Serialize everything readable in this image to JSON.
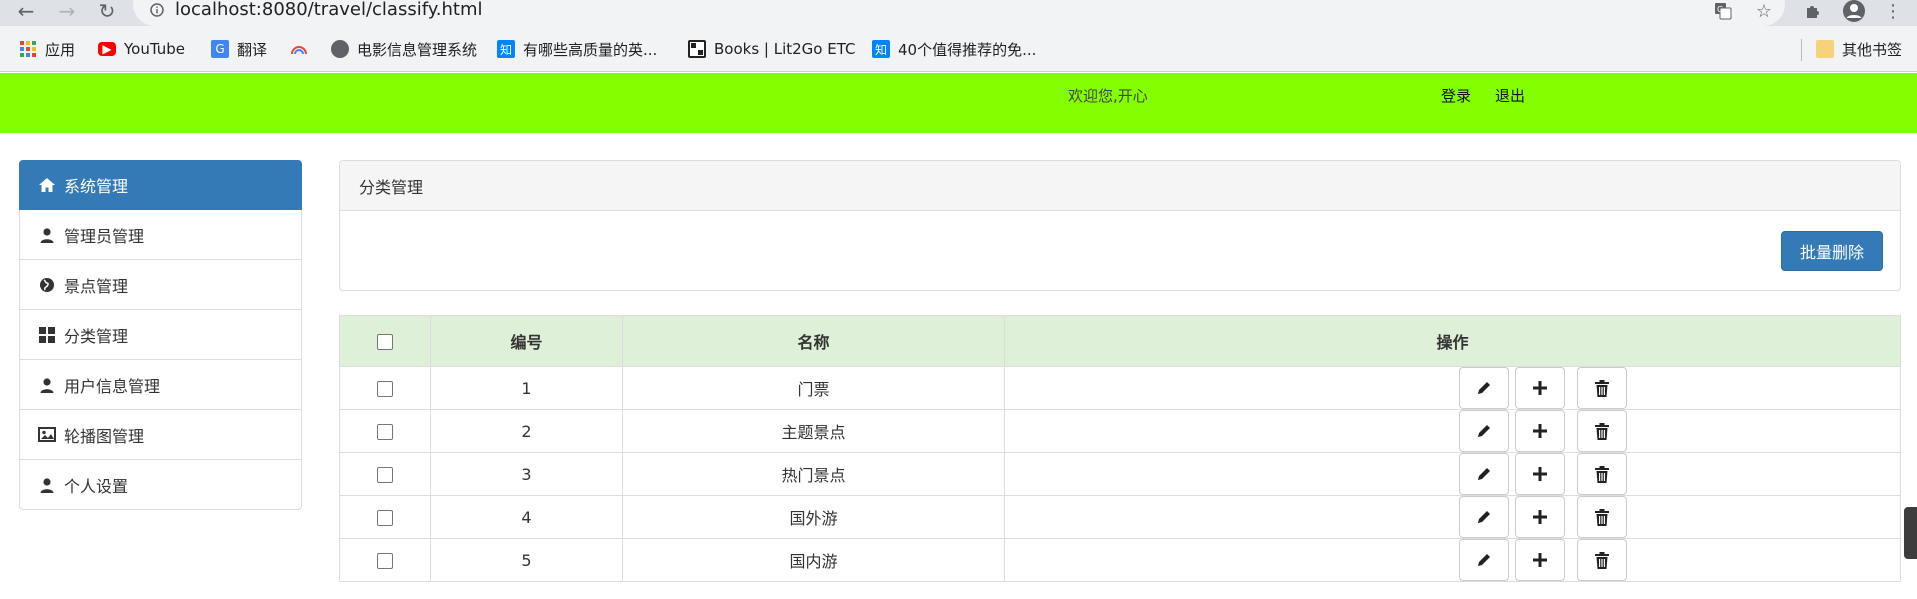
{
  "browser": {
    "url": "localhost:8080/travel/classify.html",
    "bookmarks": [
      {
        "label": "应用",
        "icon": "apps-grid-icon"
      },
      {
        "label": "YouTube",
        "icon": "youtube-icon"
      },
      {
        "label": "翻译",
        "icon": "translate-icon"
      },
      {
        "label": "",
        "icon": "rainbow-icon"
      },
      {
        "label": "电影信息管理系统",
        "icon": "globe-icon"
      },
      {
        "label": "有哪些高质量的英...",
        "icon": "zhihu-icon"
      },
      {
        "label": "Books | Lit2Go ETC",
        "icon": "lit2go-icon"
      },
      {
        "label": "40个值得推荐的免...",
        "icon": "zhihu-icon"
      }
    ],
    "other_bookmarks": "其他书签"
  },
  "header": {
    "welcome": "欢迎您,开心",
    "login": "登录",
    "logout": "退出",
    "bg_color": "#84ff00"
  },
  "sidebar": {
    "items": [
      {
        "label": "系统管理",
        "icon": "home-icon",
        "active": true
      },
      {
        "label": "管理员管理",
        "icon": "user-icon"
      },
      {
        "label": "景点管理",
        "icon": "globe-icon"
      },
      {
        "label": "分类管理",
        "icon": "grid-icon"
      },
      {
        "label": "用户信息管理",
        "icon": "user-icon"
      },
      {
        "label": "轮播图管理",
        "icon": "image-icon"
      },
      {
        "label": "个人设置",
        "icon": "user-icon"
      }
    ],
    "active_color": "#337ab7"
  },
  "panel": {
    "title": "分类管理",
    "batch_delete": "批量删除"
  },
  "table": {
    "headers": {
      "id": "编号",
      "name": "名称",
      "ops": "操作"
    },
    "rows": [
      {
        "id": "1",
        "name": "门票"
      },
      {
        "id": "2",
        "name": "主题景点"
      },
      {
        "id": "3",
        "name": "热门景点"
      },
      {
        "id": "4",
        "name": "国外游"
      },
      {
        "id": "5",
        "name": "国内游"
      }
    ],
    "row_actions": [
      "pencil-icon",
      "plus-icon",
      "trash-icon"
    ],
    "header_bg": "#dff0d8"
  }
}
